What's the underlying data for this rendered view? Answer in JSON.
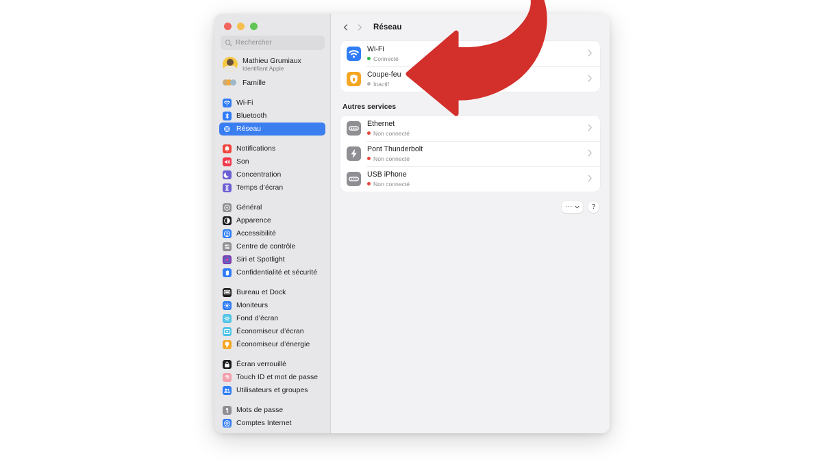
{
  "window": {
    "traffic_lights": [
      "close",
      "minimize",
      "zoom"
    ],
    "colors": {
      "accent_selected": "#3b7ef0",
      "annotation_arrow": "#d32f2b",
      "status_connected": "#2fb84a",
      "status_disconnected": "#e8453c",
      "status_inactive": "#b4b4b9",
      "sidebar_bg": "#e7e7e9",
      "content_bg": "#f2f2f4",
      "card_bg": "#ffffff"
    }
  },
  "sidebar": {
    "search": {
      "placeholder": "Rechercher",
      "icon": "search-icon",
      "value": ""
    },
    "account": {
      "name": "Mathieu Grumiaux",
      "subtitle": "Identifiant Apple",
      "avatar": "user-avatar"
    },
    "family": {
      "label": "Famille",
      "icon": "family-members-icon"
    },
    "groups": [
      {
        "items": [
          {
            "label": "Wi-Fi",
            "icon": "wifi-icon",
            "color": "#2f7cf6",
            "selected": false
          },
          {
            "label": "Bluetooth",
            "icon": "bluetooth-icon",
            "color": "#2f7cf6",
            "selected": false
          },
          {
            "label": "Réseau",
            "icon": "network-globe-icon",
            "color": "#2f7cf6",
            "selected": true
          }
        ]
      },
      {
        "items": [
          {
            "label": "Notifications",
            "icon": "notifications-icon",
            "color": "#f0453c",
            "selected": false
          },
          {
            "label": "Son",
            "icon": "sound-icon",
            "color": "#f0394a",
            "selected": false
          },
          {
            "label": "Concentration",
            "icon": "focus-moon-icon",
            "color": "#6c5fd4",
            "selected": false
          },
          {
            "label": "Temps d’écran",
            "icon": "screen-time-icon",
            "color": "#6c5fd4",
            "selected": false
          }
        ]
      },
      {
        "items": [
          {
            "label": "Général",
            "icon": "general-gear-icon",
            "color": "#8e8e93",
            "selected": false
          },
          {
            "label": "Apparence",
            "icon": "appearance-icon",
            "color": "#1c1c1e",
            "selected": false
          },
          {
            "label": "Accessibilité",
            "icon": "accessibility-icon",
            "color": "#2f7cf6",
            "selected": false
          },
          {
            "label": "Centre de contrôle",
            "icon": "control-center-icon",
            "color": "#8e8e93",
            "selected": false
          },
          {
            "label": "Siri et Spotlight",
            "icon": "siri-icon",
            "color": "#7b3fb0",
            "selected": false
          },
          {
            "label": "Confidentialité et sécurité",
            "icon": "privacy-hand-icon",
            "color": "#2f7cf6",
            "selected": false
          }
        ]
      },
      {
        "items": [
          {
            "label": "Bureau et Dock",
            "icon": "desktop-dock-icon",
            "color": "#1c1c1e",
            "selected": false
          },
          {
            "label": "Moniteurs",
            "icon": "displays-icon",
            "color": "#2f7cf6",
            "selected": false
          },
          {
            "label": "Fond d’écran",
            "icon": "wallpaper-icon",
            "color": "#4fc3e8",
            "selected": false
          },
          {
            "label": "Économiseur d’écran",
            "icon": "screensaver-icon",
            "color": "#4fc3e8",
            "selected": false
          },
          {
            "label": "Économiseur d’énergie",
            "icon": "energy-saver-icon",
            "color": "#f5a623",
            "selected": false
          }
        ]
      },
      {
        "items": [
          {
            "label": "Écran verrouillé",
            "icon": "lock-screen-icon",
            "color": "#1c1c1e",
            "selected": false
          },
          {
            "label": "Touch ID et mot de passe",
            "icon": "touch-id-icon",
            "color": "#f2a0ac",
            "selected": false
          },
          {
            "label": "Utilisateurs et groupes",
            "icon": "users-groups-icon",
            "color": "#2f7cf6",
            "selected": false
          }
        ]
      },
      {
        "items": [
          {
            "label": "Mots de passe",
            "icon": "passwords-key-icon",
            "color": "#8e8e93",
            "selected": false
          },
          {
            "label": "Comptes Internet",
            "icon": "internet-accounts-icon",
            "color": "#2f7cf6",
            "selected": false
          }
        ]
      }
    ]
  },
  "main": {
    "toolbar": {
      "back_icon": "chevron-left-icon",
      "forward_icon": "chevron-right-icon",
      "title": "Réseau"
    },
    "primary_services": [
      {
        "name": "Wi-Fi",
        "status": "Connecté",
        "status_color": "#2fb84a",
        "icon": "wifi-icon",
        "icon_color": "#2f7cf6",
        "chevron": "chevron-right-icon"
      },
      {
        "name": "Coupe-feu",
        "status": "Inactif",
        "status_color": "#b4b4b9",
        "icon": "firewall-shield-icon",
        "icon_color": "#f5a623",
        "chevron": "chevron-right-icon"
      }
    ],
    "other_services_heading": "Autres services",
    "other_services": [
      {
        "name": "Ethernet",
        "status": "Non connecté",
        "status_color": "#e8453c",
        "icon": "ethernet-icon",
        "icon_color": "#8e8e93",
        "chevron": "chevron-right-icon"
      },
      {
        "name": "Pont Thunderbolt",
        "status": "Non connecté",
        "status_color": "#e8453c",
        "icon": "thunderbolt-icon",
        "icon_color": "#8e8e93",
        "chevron": "chevron-right-icon"
      },
      {
        "name": "USB iPhone",
        "status": "Non connecté",
        "status_color": "#e8453c",
        "icon": "usb-iphone-icon",
        "icon_color": "#8e8e93",
        "chevron": "chevron-right-icon"
      }
    ],
    "footer": {
      "more_label": "···",
      "more_chevron": "chevron-down-icon",
      "help_label": "?"
    }
  },
  "annotation": {
    "type": "curved-arrow",
    "color": "#d32f2b",
    "points_to": "Coupe-feu"
  }
}
